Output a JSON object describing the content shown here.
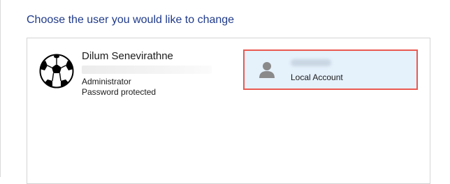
{
  "heading": "Choose the user you would like to change",
  "users": [
    {
      "name": "Dilum Senevirathne",
      "role": "Administrator",
      "security": "Password protected",
      "avatar_icon": "soccer-ball-icon"
    },
    {
      "account_type": "Local Account",
      "avatar_icon": "user-silhouette-icon",
      "selected": true
    }
  ],
  "colors": {
    "heading": "#1f3a8a",
    "selected_background": "#e5f1fb",
    "highlight_border": "#ea5a51"
  }
}
